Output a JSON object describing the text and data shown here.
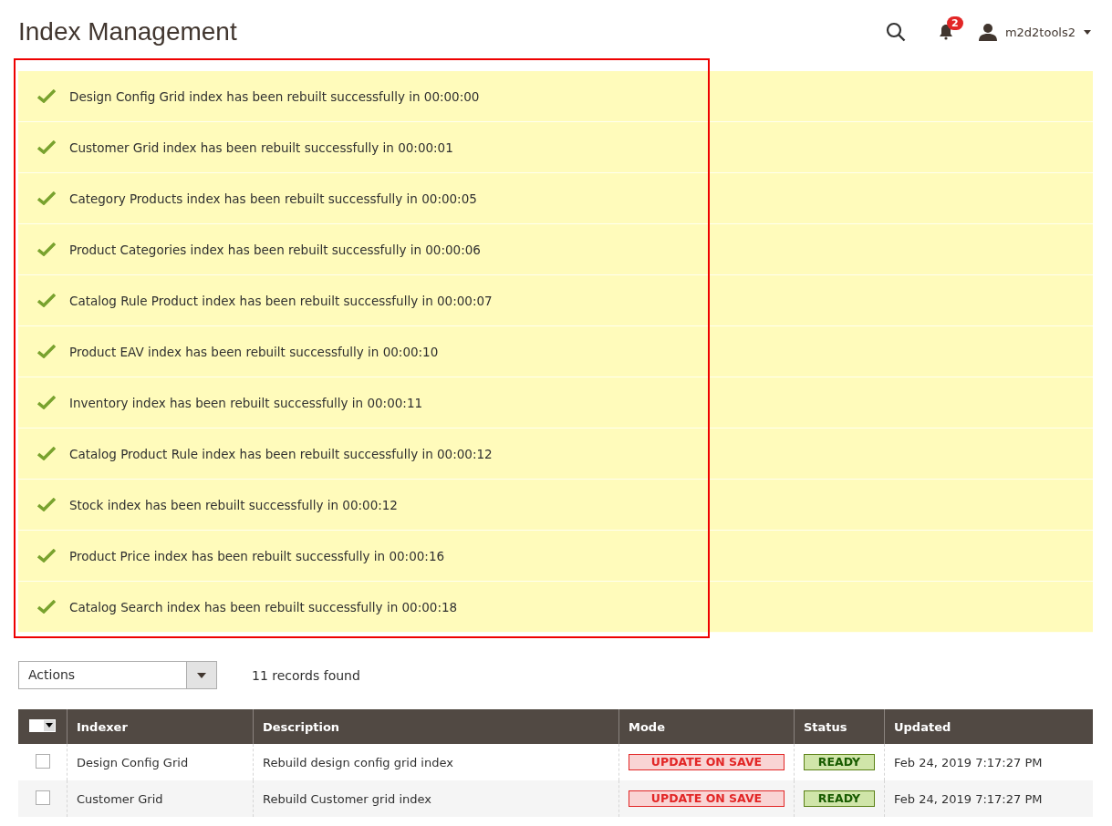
{
  "page_title": "Index Management",
  "header": {
    "notifications_count": "2",
    "username": "m2d2tools2"
  },
  "messages": [
    {
      "kind": "success",
      "text": "Design Config Grid index has been rebuilt successfully in 00:00:00"
    },
    {
      "kind": "success",
      "text": "Customer Grid index has been rebuilt successfully in 00:00:01"
    },
    {
      "kind": "success",
      "text": "Category Products index has been rebuilt successfully in 00:00:05"
    },
    {
      "kind": "success",
      "text": "Product Categories index has been rebuilt successfully in 00:00:06"
    },
    {
      "kind": "success",
      "text": "Catalog Rule Product index has been rebuilt successfully in 00:00:07"
    },
    {
      "kind": "success",
      "text": "Product EAV index has been rebuilt successfully in 00:00:10"
    },
    {
      "kind": "success",
      "text": "Inventory index has been rebuilt successfully in 00:00:11"
    },
    {
      "kind": "success",
      "text": "Catalog Product Rule index has been rebuilt successfully in 00:00:12"
    },
    {
      "kind": "success",
      "text": "Stock index has been rebuilt successfully in 00:00:12"
    },
    {
      "kind": "success",
      "text": "Product Price index has been rebuilt successfully in 00:00:16"
    },
    {
      "kind": "success",
      "text": "Catalog Search index has been rebuilt successfully in 00:00:18"
    }
  ],
  "toolbar": {
    "actions_select": "Actions",
    "records_found": "11 records found"
  },
  "table": {
    "columns": [
      "Indexer",
      "Description",
      "Mode",
      "Status",
      "Updated"
    ],
    "rows": [
      {
        "checked": false,
        "indexer": "Design Config Grid",
        "description": "Rebuild design config grid index",
        "mode": {
          "text": "UPDATE ON SAVE",
          "kind": "warning"
        },
        "status": {
          "text": "READY",
          "kind": "ok"
        },
        "updated": "Feb 24, 2019 7:17:27 PM"
      },
      {
        "checked": false,
        "indexer": "Customer Grid",
        "description": "Rebuild Customer grid index",
        "mode": {
          "text": "UPDATE ON SAVE",
          "kind": "warning"
        },
        "status": {
          "text": "READY",
          "kind": "ok"
        },
        "updated": "Feb 24, 2019 7:17:27 PM"
      }
    ]
  }
}
